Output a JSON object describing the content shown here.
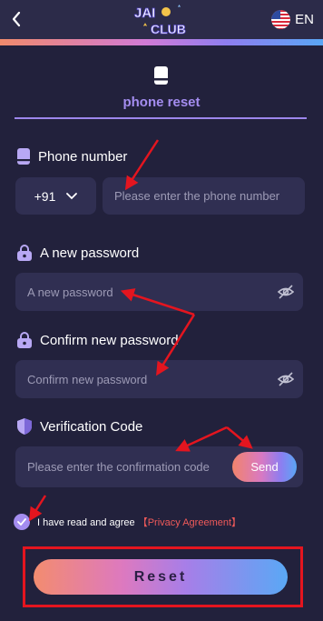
{
  "header": {
    "logo_line1": "JAI",
    "logo_line2": "CLUB",
    "language": "EN"
  },
  "tab": {
    "label": "phone reset"
  },
  "phone": {
    "label": "Phone number",
    "country_code": "+91",
    "placeholder": "Please enter the phone number"
  },
  "new_password": {
    "label": "A new password",
    "placeholder": "A new password"
  },
  "confirm_password": {
    "label": "Confirm new password",
    "placeholder": "Confirm new password"
  },
  "verification": {
    "label": "Verification Code",
    "placeholder": "Please enter the confirmation code",
    "send_label": "Send"
  },
  "agreement": {
    "text": "I have read and agree",
    "link": "【Privacy Agreement】",
    "checked": true
  },
  "reset_label": "Reset",
  "colors": {
    "background": "#22213c",
    "field": "#302f52",
    "accent": "#a48df0",
    "annotation": "#e4151f"
  },
  "icons": [
    "back-arrow-icon",
    "us-flag-icon",
    "phone-icon",
    "lock-icon",
    "shield-icon",
    "eye-off-icon",
    "check-icon",
    "chevron-down-icon"
  ]
}
